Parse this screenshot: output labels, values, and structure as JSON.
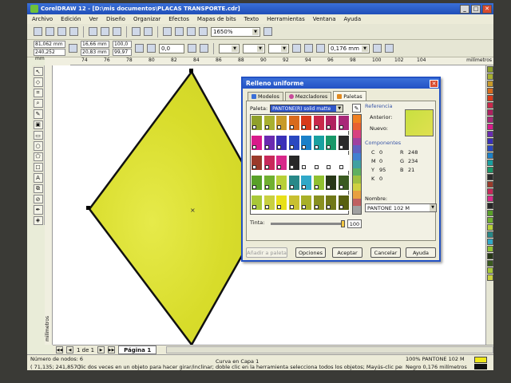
{
  "window": {
    "app": "CorelDRAW 12",
    "title": "CorelDRAW 12 - [D:\\mis documentos\\PLACAS TRANSPORTE.cdr]"
  },
  "menu": [
    "Archivo",
    "Edición",
    "Ver",
    "Diseño",
    "Organizar",
    "Efectos",
    "Mapas de bits",
    "Texto",
    "Herramientas",
    "Ventana",
    "Ayuda"
  ],
  "toolbar": {
    "zoom": "1650%"
  },
  "propbar": {
    "x": "81,062 mm",
    "y": "240,252 mm",
    "w": "16,66 mm",
    "h": "20,83 mm",
    "sx": "100,0",
    "sy": "99,97",
    "angle": "0,0",
    "outline": "0,176 mm"
  },
  "ruler": {
    "units": "milímetros",
    "h_ticks": [
      "74",
      "76",
      "78",
      "80",
      "82",
      "84",
      "86",
      "88",
      "90",
      "92",
      "94",
      "96",
      "98",
      "100",
      "102",
      "104"
    ]
  },
  "pages": {
    "counter": "1 de 1",
    "tab": "Página 1"
  },
  "status": {
    "nodes": "Número de nodos: 6",
    "object": "Curva en Capa 1",
    "coords": "( 71,135; 241,857 )",
    "hint": "Clic dos veces en un objeto para hacer girar/inclinar; doble clic en la herramienta selecciona todos los objetos; Mayús-clic permite la selección ...",
    "fill": "100% PANTONE 102 M",
    "outline": "Negro  0,176 milímetros"
  },
  "dialog": {
    "title": "Relleno uniforme",
    "tabs": [
      "Modelos",
      "Mezcladores",
      "Paletas"
    ],
    "paleta_label": "Paleta:",
    "paleta_value": "PANTONE(R) solid matte",
    "ref_title": "Referencia",
    "anterior": "Anterior:",
    "nuevo": "Nuevo:",
    "comp_title": "Componentes",
    "components": [
      {
        "k": "C",
        "v": "0",
        "k2": "R",
        "v2": "248"
      },
      {
        "k": "M",
        "v": "0",
        "k2": "G",
        "v2": "234"
      },
      {
        "k": "Y",
        "v": "95",
        "k2": "B",
        "v2": "21"
      },
      {
        "k": "K",
        "v": "0",
        "k2": "",
        "v2": ""
      }
    ],
    "nombre_label": "Nombre:",
    "nombre_value": "PANTONE 102 M",
    "tinta_label": "Tinta:",
    "tinta_value": "100",
    "buttons": {
      "add": "Añadir a paleta",
      "options": "Opciones",
      "ok": "Aceptar",
      "cancel": "Cancelar",
      "help": "Ayuda"
    }
  },
  "colors": {
    "diamond_fill": "#e8e030",
    "accent": "#2352c4",
    "selected_fill": "#f8ea15"
  },
  "swatches": [
    [
      "#8fa02a",
      "#a8b030",
      "#c89a28",
      "#d86a1c",
      "#d83a1a",
      "#c8284a",
      "#b02060",
      "#a82878"
    ],
    [
      "#d81a8a",
      "#6a2ab0",
      "#3a30b8",
      "#2a48c0",
      "#1a80c8",
      "#18a0a0",
      "#189868",
      "#2a2a2a"
    ],
    [
      "#9a3a2a",
      "#c8285a",
      "#d8288a",
      "#282828",
      "#ffffff",
      "#ffffff",
      "#ffffff",
      "#ffffff"
    ],
    [
      "#58a028",
      "#70b030",
      "#b8d038",
      "#288888",
      "#30a8c8",
      "#90c030",
      "#283818",
      "#3a5a20"
    ],
    [
      "#a8c838",
      "#c8d040",
      "#e8e018",
      "#c8c030",
      "#a8b028",
      "#889020",
      "#707818",
      "#586010"
    ]
  ],
  "vstrip": [
    "#f08020",
    "#e86030",
    "#d84080",
    "#a040a0",
    "#6060c0",
    "#4080d0",
    "#40a0a0",
    "#60b060",
    "#a0c040",
    "#d0d040",
    "#e8a040",
    "#c06060",
    "#a0a0a0"
  ]
}
